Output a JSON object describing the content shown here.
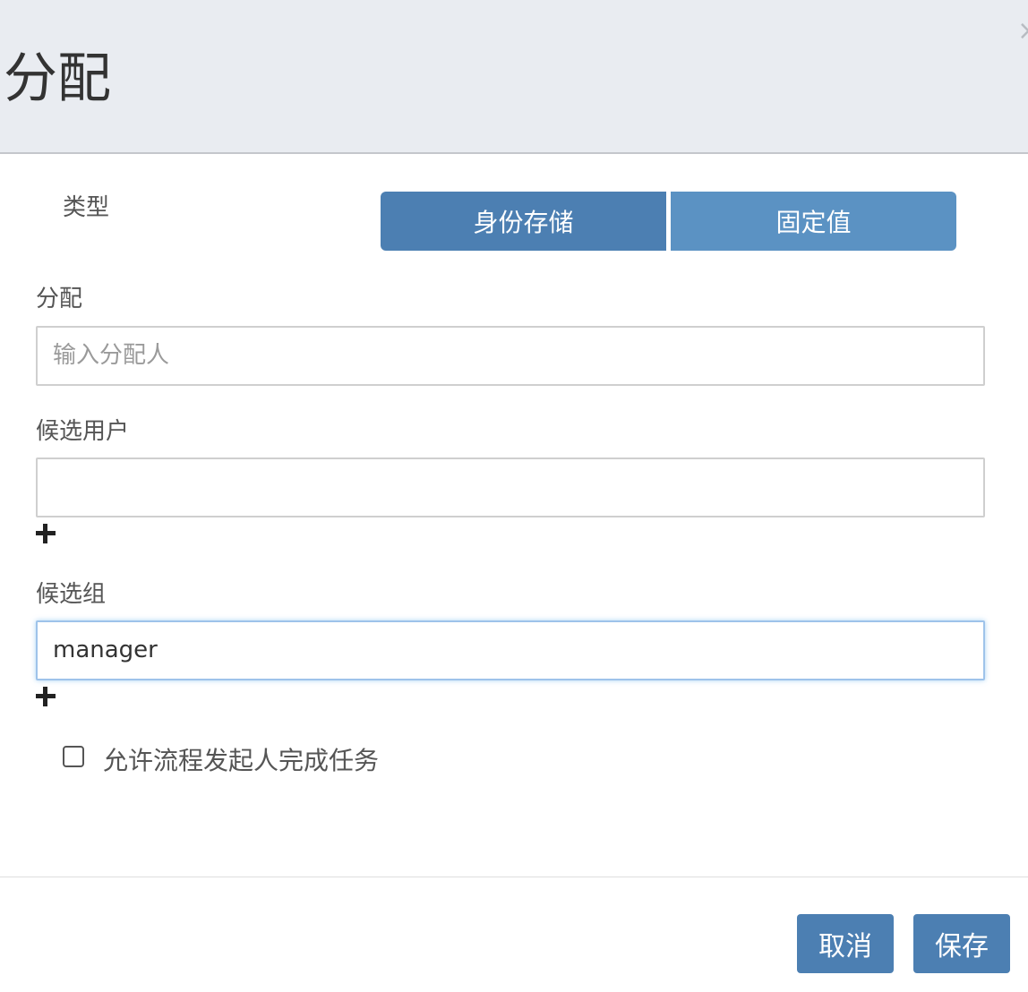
{
  "dialog": {
    "title": "分配",
    "close_icon": "×"
  },
  "type_section": {
    "label": "类型",
    "options": [
      "身份存储",
      "固定值"
    ],
    "colors": {
      "left": "#4c7fb2",
      "right": "#5b92c3"
    }
  },
  "assignee": {
    "label": "分配",
    "placeholder": "输入分配人",
    "value": ""
  },
  "candidate_users": {
    "label": "候选用户",
    "value": ""
  },
  "candidate_groups": {
    "label": "候选组",
    "value": "manager"
  },
  "allow_initiator": {
    "label": "允许流程发起人完成任务",
    "checked": false
  },
  "footer": {
    "cancel_label": "取消",
    "save_label": "保存"
  }
}
